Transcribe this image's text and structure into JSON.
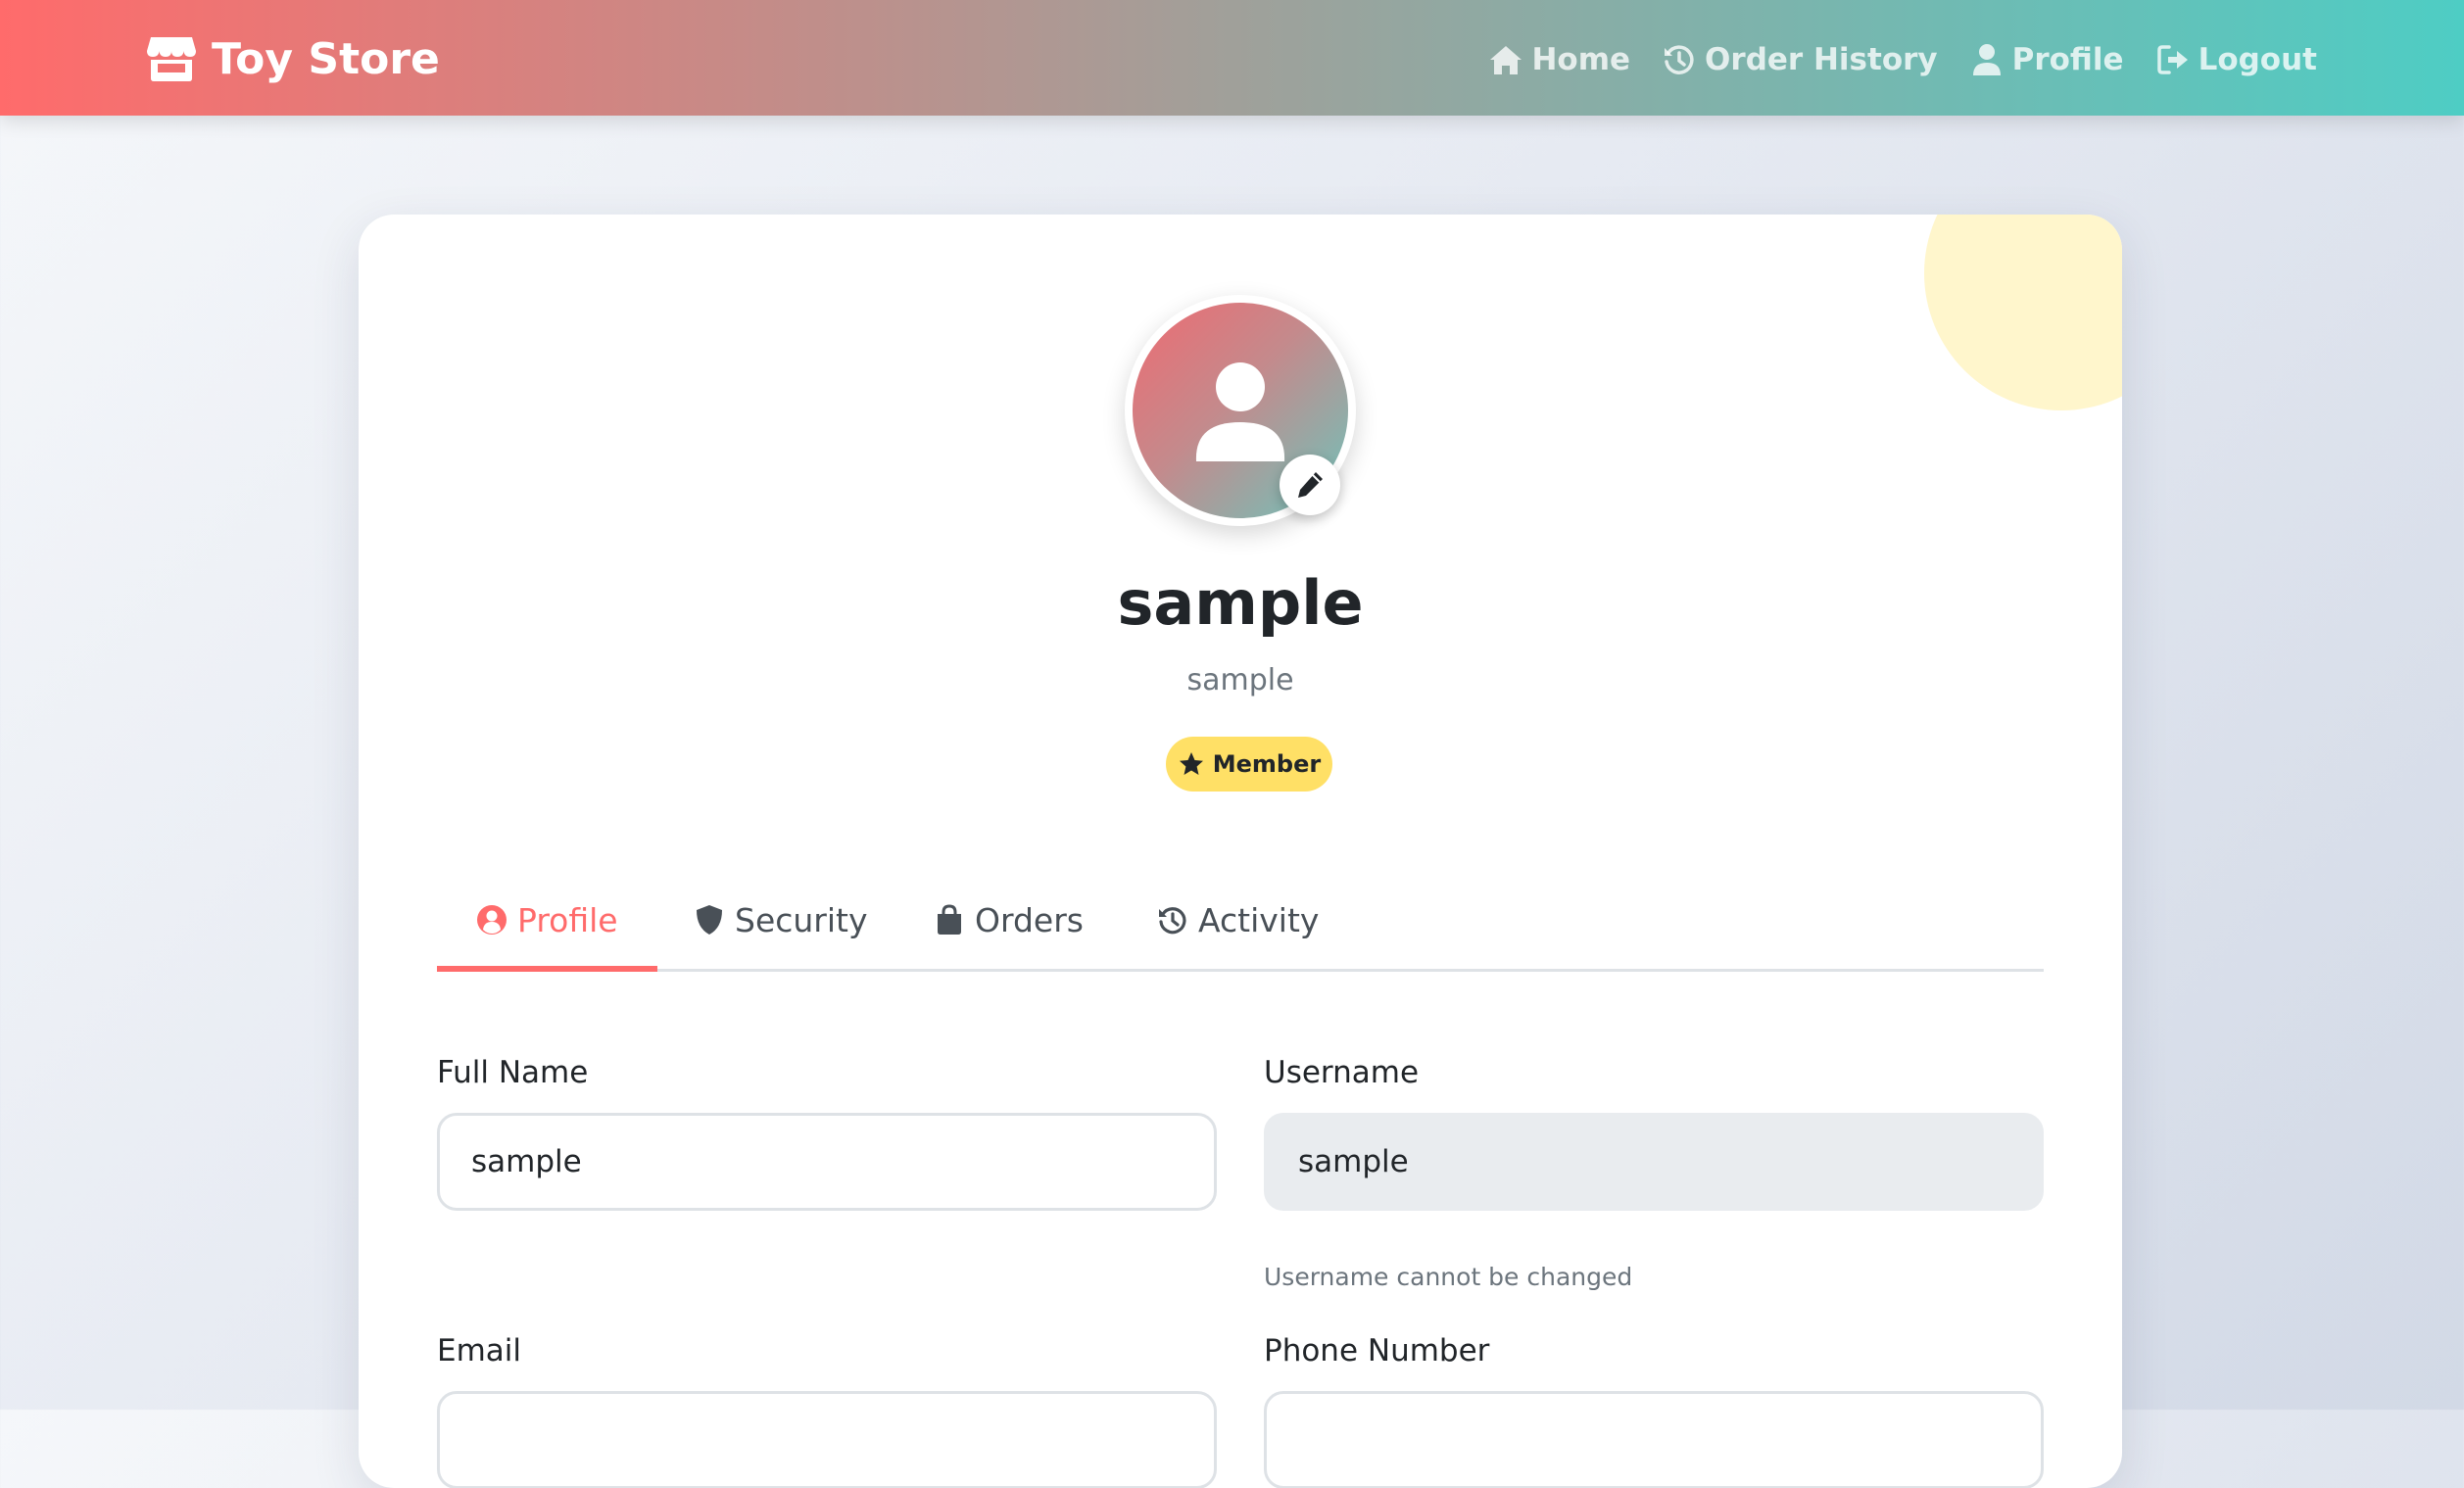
{
  "navbar": {
    "brand": "Toy Store",
    "links": [
      {
        "label": "Home",
        "icon": "home-icon"
      },
      {
        "label": "Order History",
        "icon": "history-icon"
      },
      {
        "label": "Profile",
        "icon": "user-icon"
      },
      {
        "label": "Logout",
        "icon": "logout-icon"
      }
    ]
  },
  "profile": {
    "name": "sample",
    "username": "sample",
    "badge": "Member"
  },
  "tabs": [
    {
      "label": "Profile",
      "icon": "user-circle-icon",
      "active": true
    },
    {
      "label": "Security",
      "icon": "shield-icon",
      "active": false
    },
    {
      "label": "Orders",
      "icon": "shopping-bag-icon",
      "active": false
    },
    {
      "label": "Activity",
      "icon": "history-icon",
      "active": false
    }
  ],
  "form": {
    "full_name": {
      "label": "Full Name",
      "value": "sample"
    },
    "username": {
      "label": "Username",
      "value": "sample",
      "hint": "Username cannot be changed"
    },
    "email": {
      "label": "Email",
      "value": ""
    },
    "phone": {
      "label": "Phone Number",
      "value": ""
    }
  },
  "colors": {
    "accent": "#ff6b6b",
    "teal": "#4ecdc4",
    "badge": "#ffe066"
  }
}
